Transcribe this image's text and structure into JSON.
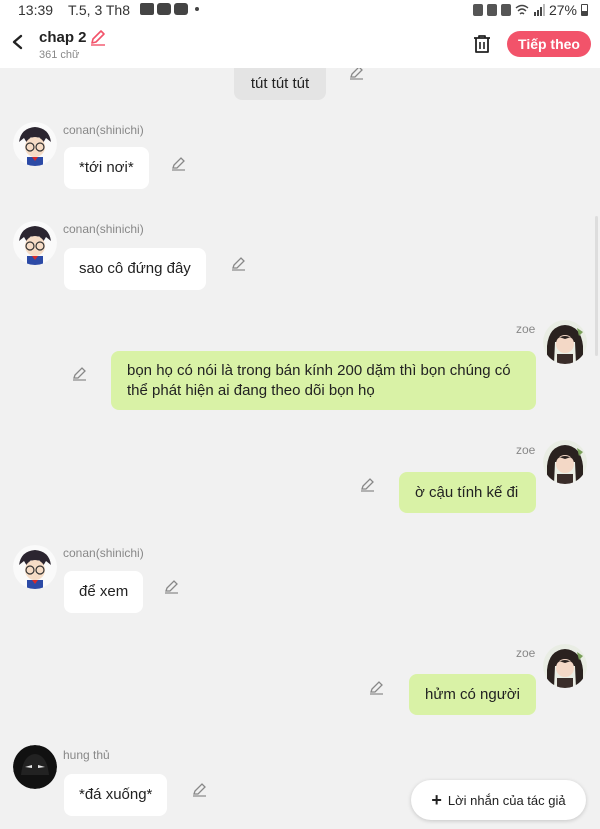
{
  "status_bar": {
    "time": "13:39",
    "date": "T.5, 3 Th8",
    "battery": "27%"
  },
  "header": {
    "title": "chap 2",
    "word_count": "361 chữ",
    "next_label": "Tiếp theo"
  },
  "colors": {
    "accent": "#f2536a",
    "own_bubble": "#d9f2a6",
    "other_bubble": "#ffffff",
    "narration_bubble": "#e4e4e4"
  },
  "messages": [
    {
      "sender": "",
      "text": "tút tút tút",
      "side": "center"
    },
    {
      "sender": "conan(shinichi)",
      "text": "*tới nơi*",
      "side": "left"
    },
    {
      "sender": "conan(shinichi)",
      "text": "sao cô đứng đây",
      "side": "left"
    },
    {
      "sender": "zoe",
      "text": "bọn họ có nói là trong bán kính 200 dặm thì bọn chúng có thể phát hiện ai đang theo dõi bọn họ",
      "side": "right"
    },
    {
      "sender": "zoe",
      "text": "ờ cậu tính kế đi",
      "side": "right"
    },
    {
      "sender": "conan(shinichi)",
      "text": "để xem",
      "side": "left"
    },
    {
      "sender": "zoe",
      "text": "hửm có người",
      "side": "right"
    },
    {
      "sender": "hung thủ",
      "text": "*đá xuống*",
      "side": "left"
    }
  ],
  "author_note_button": {
    "label": "Lời nhắn của tác giả"
  },
  "icons": [
    "back-arrow-icon",
    "pencil-icon",
    "trash-icon",
    "plus-icon",
    "avatar-conan",
    "avatar-zoe",
    "avatar-hung-thu"
  ]
}
